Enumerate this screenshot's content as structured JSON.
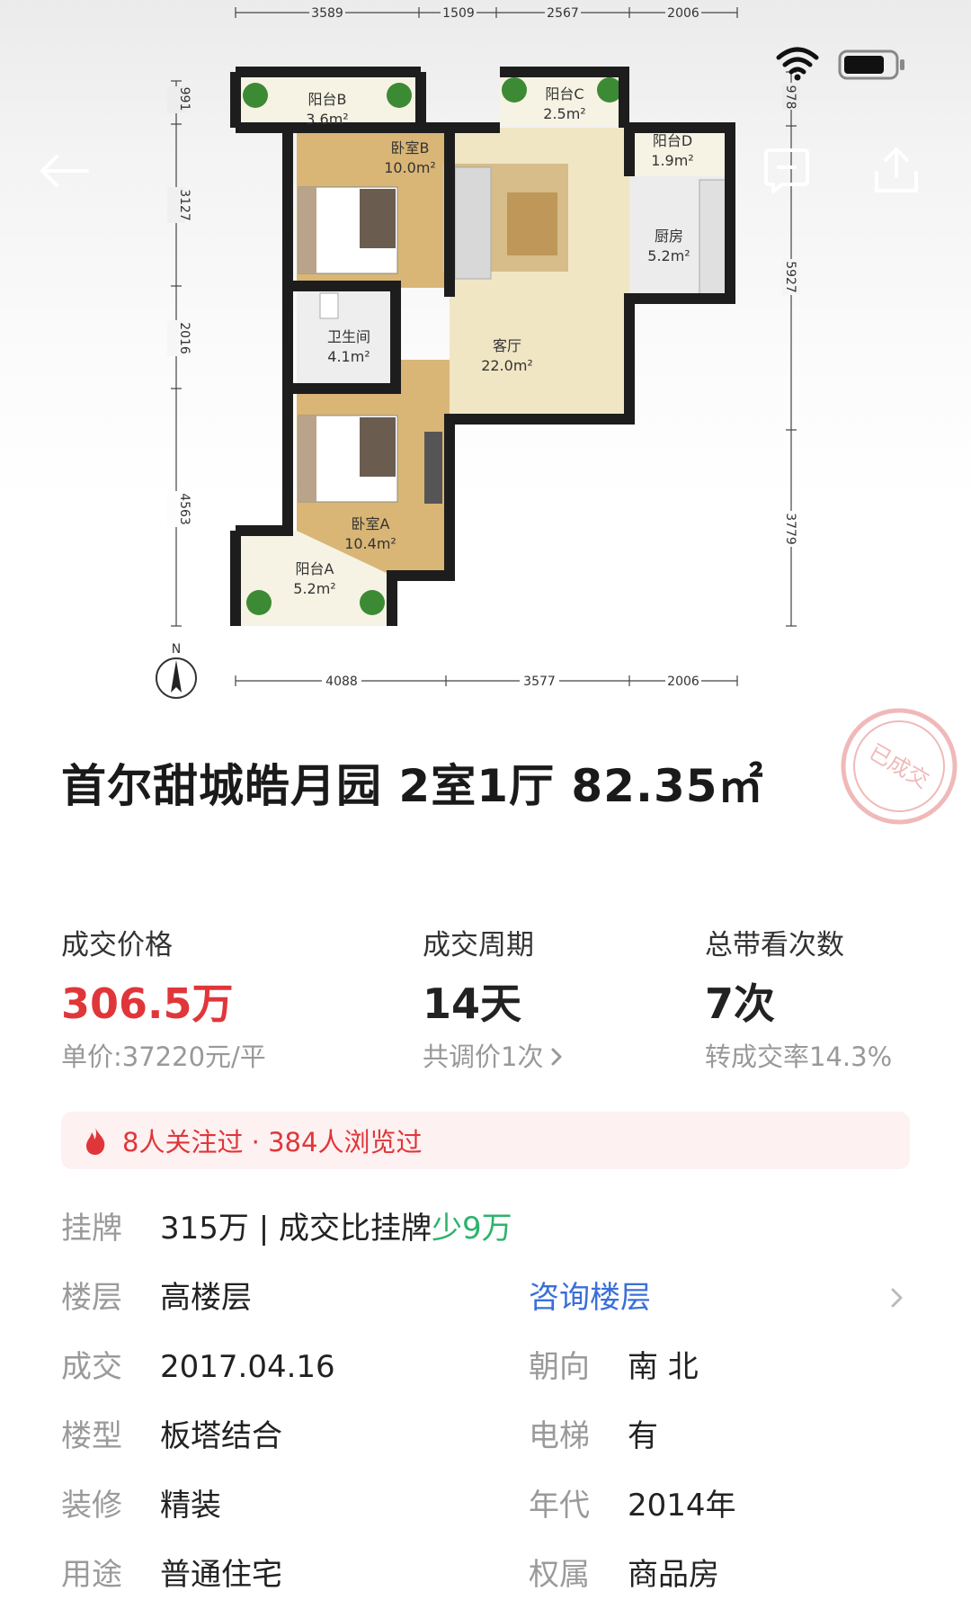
{
  "floorplan": {
    "dims_top": [
      "3589",
      "1509",
      "2567",
      "2006"
    ],
    "dims_bottom": [
      "4088",
      "3577",
      "2006"
    ],
    "dims_left": [
      "991",
      "3127",
      "2016",
      "4563"
    ],
    "dims_right": [
      "978",
      "5927",
      "3779"
    ],
    "compass_label": "N",
    "rooms": [
      {
        "name": "阳台B",
        "area": "3.6m²"
      },
      {
        "name": "阳台C",
        "area": "2.5m²"
      },
      {
        "name": "阳台D",
        "area": "1.9m²"
      },
      {
        "name": "卧室B",
        "area": "10.0m²"
      },
      {
        "name": "厨房",
        "area": "5.2m²"
      },
      {
        "name": "卫生间",
        "area": "4.1m²"
      },
      {
        "name": "客厅",
        "area": "22.0m²"
      },
      {
        "name": "卧室A",
        "area": "10.4m²"
      },
      {
        "name": "阳台A",
        "area": "5.2m²"
      }
    ]
  },
  "stamp_text": "已成交",
  "listing": {
    "title": "首尔甜城皓月园 2室1厅 82.35㎡"
  },
  "stats": {
    "price": {
      "label": "成交价格",
      "value": "306.5万",
      "sub": "单价:37220元/平"
    },
    "cycle": {
      "label": "成交周期",
      "value": "14天",
      "sub": "共调价1次"
    },
    "views": {
      "label": "总带看次数",
      "value": "7次",
      "sub": "转成交率14.3%"
    }
  },
  "attention_text": "8人关注过 · 384人浏览过",
  "details": {
    "listing_label": "挂牌",
    "listing_value": "315万 | 成交比挂牌",
    "listing_diff": "少9万",
    "floor_label": "楼层",
    "floor_value": "高楼层",
    "floor_link": "咨询楼层",
    "deal_label": "成交",
    "deal_value": "2017.04.16",
    "orient_label": "朝向",
    "orient_value": "南 北",
    "type_label": "楼型",
    "type_value": "板塔结合",
    "elevator_label": "电梯",
    "elevator_value": "有",
    "decor_label": "装修",
    "decor_value": "精装",
    "year_label": "年代",
    "year_value": "2014年",
    "usage_label": "用途",
    "usage_value": "普通住宅",
    "owner_label": "权属",
    "owner_value": "商品房"
  },
  "colors": {
    "accent_red": "#e0363a",
    "green": "#2db36c",
    "link_blue": "#3a6fd8",
    "label_gray": "#9a9a9a"
  }
}
